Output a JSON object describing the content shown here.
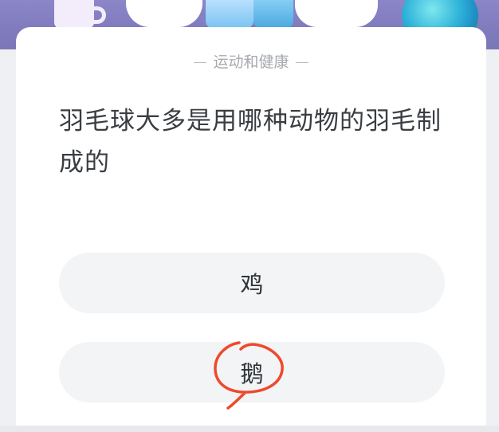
{
  "category": "运动和健康",
  "question": "羽毛球大多是用哪种动物的羽毛制成的",
  "options": [
    {
      "label": "鸡"
    },
    {
      "label": "鹅"
    }
  ],
  "colors": {
    "header": "#8c86c9",
    "card": "#ffffff",
    "option_bg": "#f2f4f6",
    "annotation": "#ee4a2c"
  },
  "icons": {
    "mug": "mug-icon",
    "cloud": "cloud-icon",
    "glass": "glass-icon",
    "globe": "globe-icon",
    "circle_annotation": "hand-drawn-circle"
  }
}
